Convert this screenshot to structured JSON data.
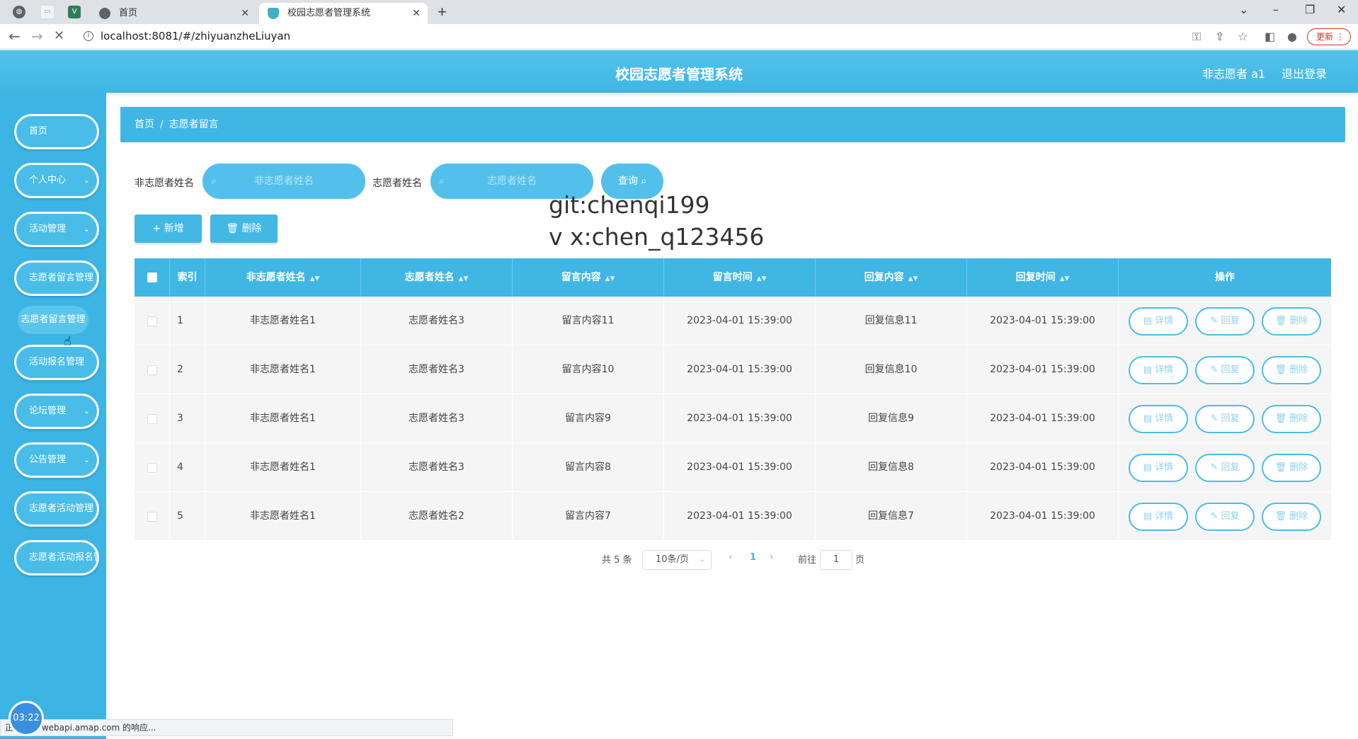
{
  "browser": {
    "tabs": [
      {
        "label": "首页"
      },
      {
        "label": "校园志愿者管理系统"
      }
    ],
    "url": "localhost:8081/#/zhiyuanzheLiuyan",
    "update_label": "更新"
  },
  "header": {
    "title": "校园志愿者管理系统",
    "user": "非志愿者 a1",
    "logout": "退出登录"
  },
  "sidebar": {
    "items": [
      {
        "label": "首页"
      },
      {
        "label": "个人中心"
      },
      {
        "label": "活动管理"
      },
      {
        "label": "志愿者留言管理"
      },
      {
        "label": "志愿者留言管理"
      },
      {
        "label": "活动报名管理"
      },
      {
        "label": "论坛管理"
      },
      {
        "label": "公告管理"
      },
      {
        "label": "志愿者活动管理"
      },
      {
        "label": "志愿者活动报名管理"
      }
    ]
  },
  "breadcrumb": {
    "home": "首页",
    "sep": "/",
    "current": "志愿者留言"
  },
  "search": {
    "label1": "非志愿者姓名",
    "placeholder1": "非志愿者姓名",
    "label2": "志愿者姓名",
    "placeholder2": "志愿者姓名",
    "query": "查询 ⌕"
  },
  "watermark": {
    "line1": "git:chenqi199",
    "line2": "v x:chen_q123456"
  },
  "actions": {
    "add": "+ 新增",
    "delete": "🗑 删除"
  },
  "table": {
    "headers": {
      "index": "索引",
      "non_volunteer": "非志愿者姓名",
      "volunteer": "志愿者姓名",
      "content": "留言内容",
      "time": "留言时间",
      "reply": "回复内容",
      "reply_time": "回复时间",
      "ops": "操作"
    },
    "rows": [
      {
        "index": "1",
        "non_volunteer": "非志愿者姓名1",
        "volunteer": "志愿者姓名3",
        "content": "留言内容11",
        "time": "2023-04-01 15:39:00",
        "reply": "回复信息11",
        "reply_time": "2023-04-01 15:39:00"
      },
      {
        "index": "2",
        "non_volunteer": "非志愿者姓名1",
        "volunteer": "志愿者姓名3",
        "content": "留言内容10",
        "time": "2023-04-01 15:39:00",
        "reply": "回复信息10",
        "reply_time": "2023-04-01 15:39:00"
      },
      {
        "index": "3",
        "non_volunteer": "非志愿者姓名1",
        "volunteer": "志愿者姓名3",
        "content": "留言内容9",
        "time": "2023-04-01 15:39:00",
        "reply": "回复信息9",
        "reply_time": "2023-04-01 15:39:00"
      },
      {
        "index": "4",
        "non_volunteer": "非志愿者姓名1",
        "volunteer": "志愿者姓名3",
        "content": "留言内容8",
        "time": "2023-04-01 15:39:00",
        "reply": "回复信息8",
        "reply_time": "2023-04-01 15:39:00"
      },
      {
        "index": "5",
        "non_volunteer": "非志愿者姓名1",
        "volunteer": "志愿者姓名2",
        "content": "留言内容7",
        "time": "2023-04-01 15:39:00",
        "reply": "回复信息7",
        "reply_time": "2023-04-01 15:39:00"
      }
    ],
    "op_labels": {
      "detail": "▤ 详情",
      "reply": "✎ 回复",
      "delete": "🗑 删除"
    }
  },
  "pagination": {
    "total": "共 5 条",
    "page_size": "10条/页",
    "current_page": "1",
    "goto_label": "前往",
    "goto_value": "1",
    "page_suffix": "页"
  },
  "status": {
    "loading_text": "正在等待 webapi.amap.com 的响应...",
    "timer": "03:22"
  },
  "colors": {
    "primary": "#3fb6e3",
    "sidebar": "#3cb5e5",
    "row_bg": "#f5f5f5"
  }
}
